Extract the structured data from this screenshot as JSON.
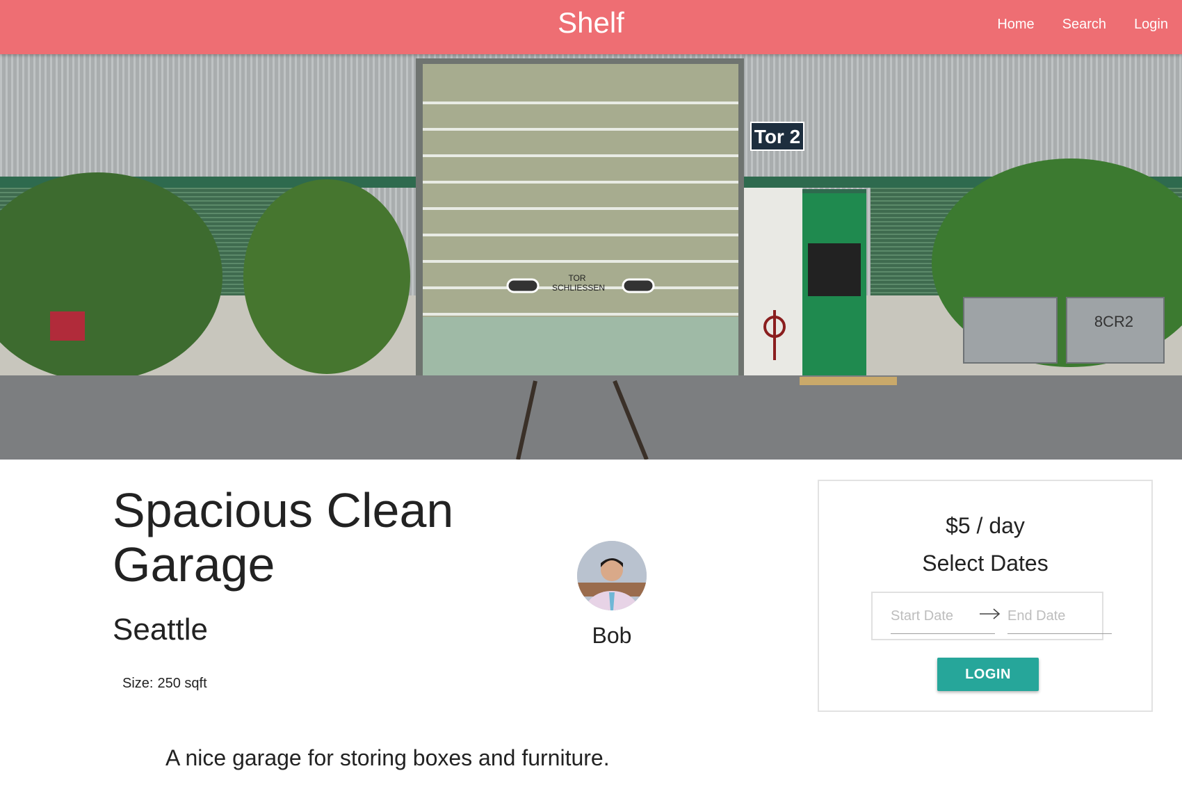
{
  "navbar": {
    "brand": "Shelf",
    "links": [
      "Home",
      "Search",
      "Login"
    ],
    "color": "#ee6e73"
  },
  "hero": {
    "door_sign": "Tor 2",
    "door_text_line1": "TOR",
    "door_text_line2": "SCHLIESSEN",
    "bin_text": "8CR2"
  },
  "listing": {
    "title": "Spacious Clean Garage",
    "city": "Seattle",
    "size_label": "Size:",
    "size_value": "250 sqft",
    "description": "A nice garage for storing boxes and furniture."
  },
  "host": {
    "name": "Bob"
  },
  "booking": {
    "price": "$5 / day",
    "heading": "Select Dates",
    "start_placeholder": "Start Date",
    "end_placeholder": "End Date",
    "button_label": "LOGIN",
    "button_color": "#26a69a"
  }
}
